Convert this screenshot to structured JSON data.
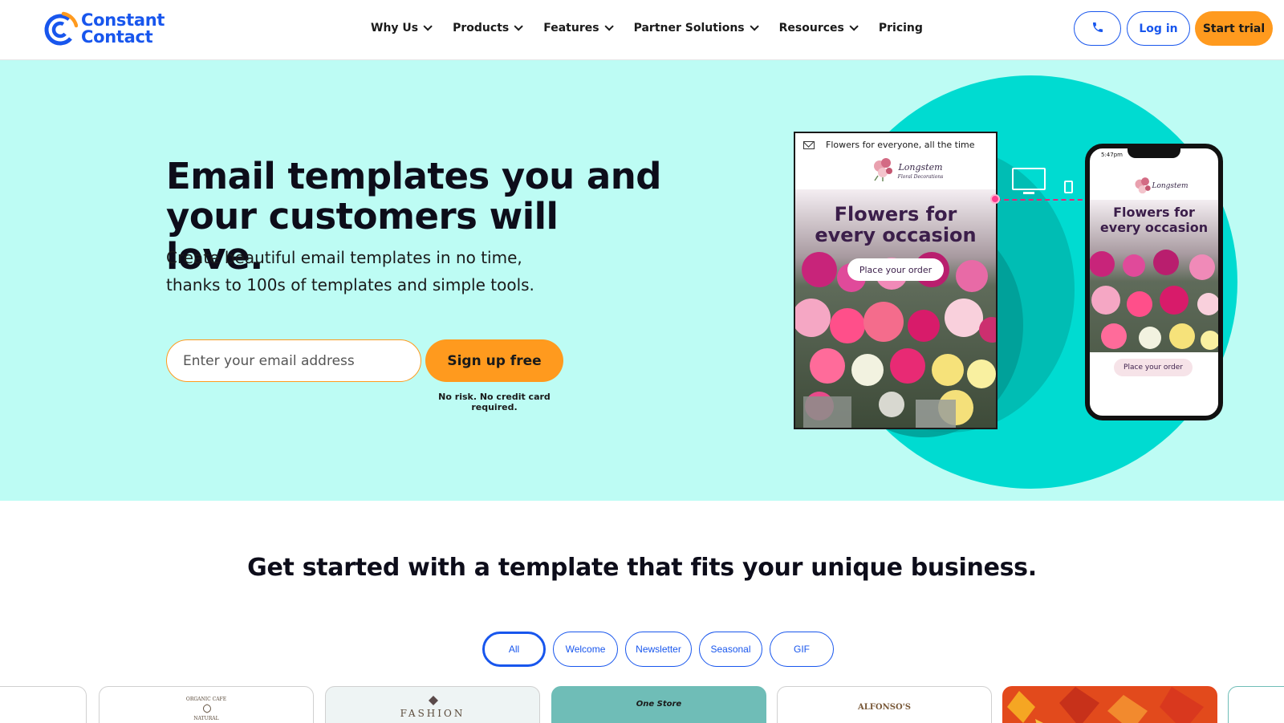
{
  "header": {
    "logo": {
      "line1": "Constant",
      "line2": "Contact"
    },
    "nav": [
      {
        "label": "Why Us",
        "has_dropdown": true
      },
      {
        "label": "Products",
        "has_dropdown": true
      },
      {
        "label": "Features",
        "has_dropdown": true
      },
      {
        "label": "Partner Solutions",
        "has_dropdown": true
      },
      {
        "label": "Resources",
        "has_dropdown": true
      },
      {
        "label": "Pricing",
        "has_dropdown": false
      }
    ],
    "phone_icon": "phone-icon",
    "login_label": "Log in",
    "trial_label": "Start trial"
  },
  "hero": {
    "title_line1": "Email templates you and",
    "title_line2": "your customers will love.",
    "subtitle_line1": "Create beautiful email templates in no time,",
    "subtitle_line2": "thanks to 100s of templates and simple tools.",
    "email_placeholder": "Enter your email address",
    "signup_label": "Sign up free",
    "no_risk": "No risk. No credit card required.",
    "illustration": {
      "email_subject": "Flowers for everyone, all the time",
      "brand": "Longstem",
      "brand_sub": "Floral Decorations",
      "headline_line1": "Flowers for",
      "headline_line2": "every occasion",
      "cta": "Place your order",
      "phone_time": "5:47pm"
    }
  },
  "templates": {
    "title": "Get started with a template that fits your unique business.",
    "filters": [
      {
        "label": "All",
        "active": true
      },
      {
        "label": "Welcome",
        "active": false
      },
      {
        "label": "Newsletter",
        "active": false
      },
      {
        "label": "Seasonal",
        "active": false
      },
      {
        "label": "GIF",
        "active": false
      }
    ],
    "cards": [
      {
        "logo": "ORGANIC CAFE",
        "logo_sub": "NATURAL"
      },
      {
        "logo": "FASHION"
      },
      {
        "logo": "One Store"
      },
      {
        "logo": "ALFONSO'S"
      },
      {
        "logo": ""
      }
    ]
  },
  "colors": {
    "brand_blue": "#1856ed",
    "accent_orange": "#ff9a1e",
    "hero_bg": "#bdfcf4",
    "teal": "#00dbd1",
    "pink": "#ff3c8e"
  }
}
